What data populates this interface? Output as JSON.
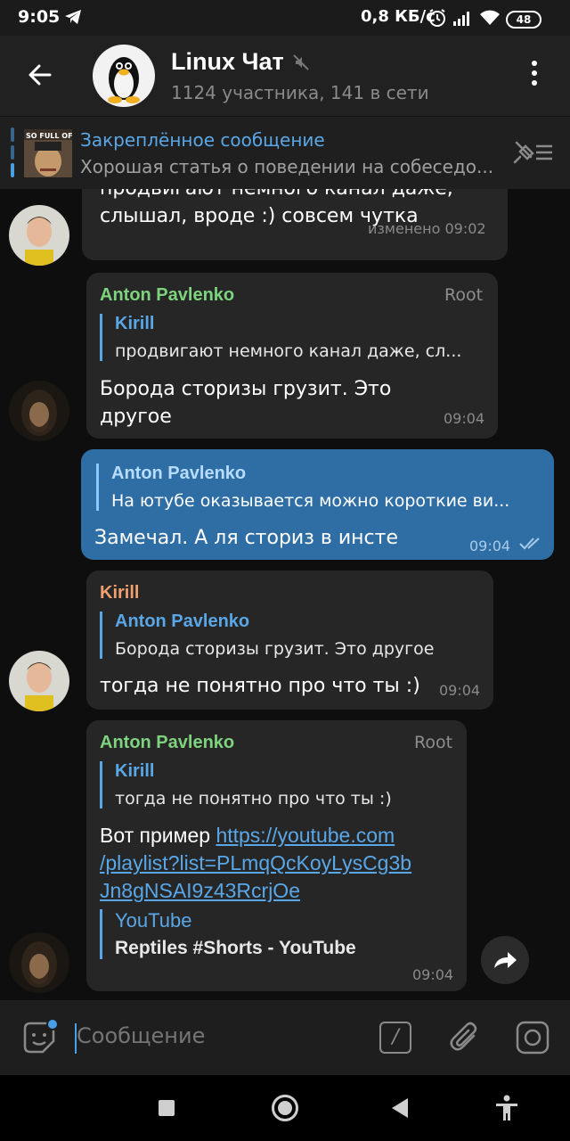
{
  "status_bar": {
    "time": "9:05",
    "speed": "0,8 КБ/с",
    "battery": "48"
  },
  "header": {
    "title": "Linux Чат",
    "subtitle": "1124 участника, 141 в сети"
  },
  "pinned": {
    "title": "Закреплённое сообщение",
    "text": "Хорошая статья о поведении на собеседо...",
    "thumb_caption": "SO FULL OF SI"
  },
  "messages": [
    {
      "text": "продвигают немного канал даже, слышал, вроде :) совсем чутка",
      "time": "изменено 09:02"
    },
    {
      "sender": "Anton Pavlenko",
      "role": "Root",
      "reply_name": "Kirill",
      "reply_text": "продвигают немного канал даже, сл...",
      "text": "Борода сторизы грузит. Это другое",
      "time": "09:04"
    },
    {
      "reply_name": "Anton Pavlenko",
      "reply_text": "На ютубе оказывается можно короткие ви...",
      "text": "Замечал. А ля сториз в инсте",
      "time": "09:04"
    },
    {
      "sender": "Kirill",
      "reply_name": "Anton Pavlenko",
      "reply_text": "Борода сторизы грузит. Это другое",
      "text": "тогда не понятно про что ты :)",
      "time": "09:04"
    },
    {
      "sender": "Anton Pavlenko",
      "role": "Root",
      "reply_name": "Kirill",
      "reply_text": "тогда не понятно про что ты :)",
      "text": "Вот пример",
      "link_line1": "https://youtube.com",
      "link_line2": "/playlist?list=PLmqQcKoyLysCg3b",
      "link_line3": "Jn8gNSAI9z43RcrjOe",
      "preview_site": "YouTube",
      "preview_title": "Reptiles #Shorts - YouTube",
      "time": "09:04"
    }
  ],
  "input": {
    "placeholder": "Сообщение",
    "cmd_label": "/"
  },
  "colors": {
    "accent": "#5aa7e8",
    "outgoing_bubble": "#2f6ea5",
    "incoming_bubble": "#262626",
    "sender_anton": "#7ed37e",
    "sender_kirill": "#f0a070"
  }
}
